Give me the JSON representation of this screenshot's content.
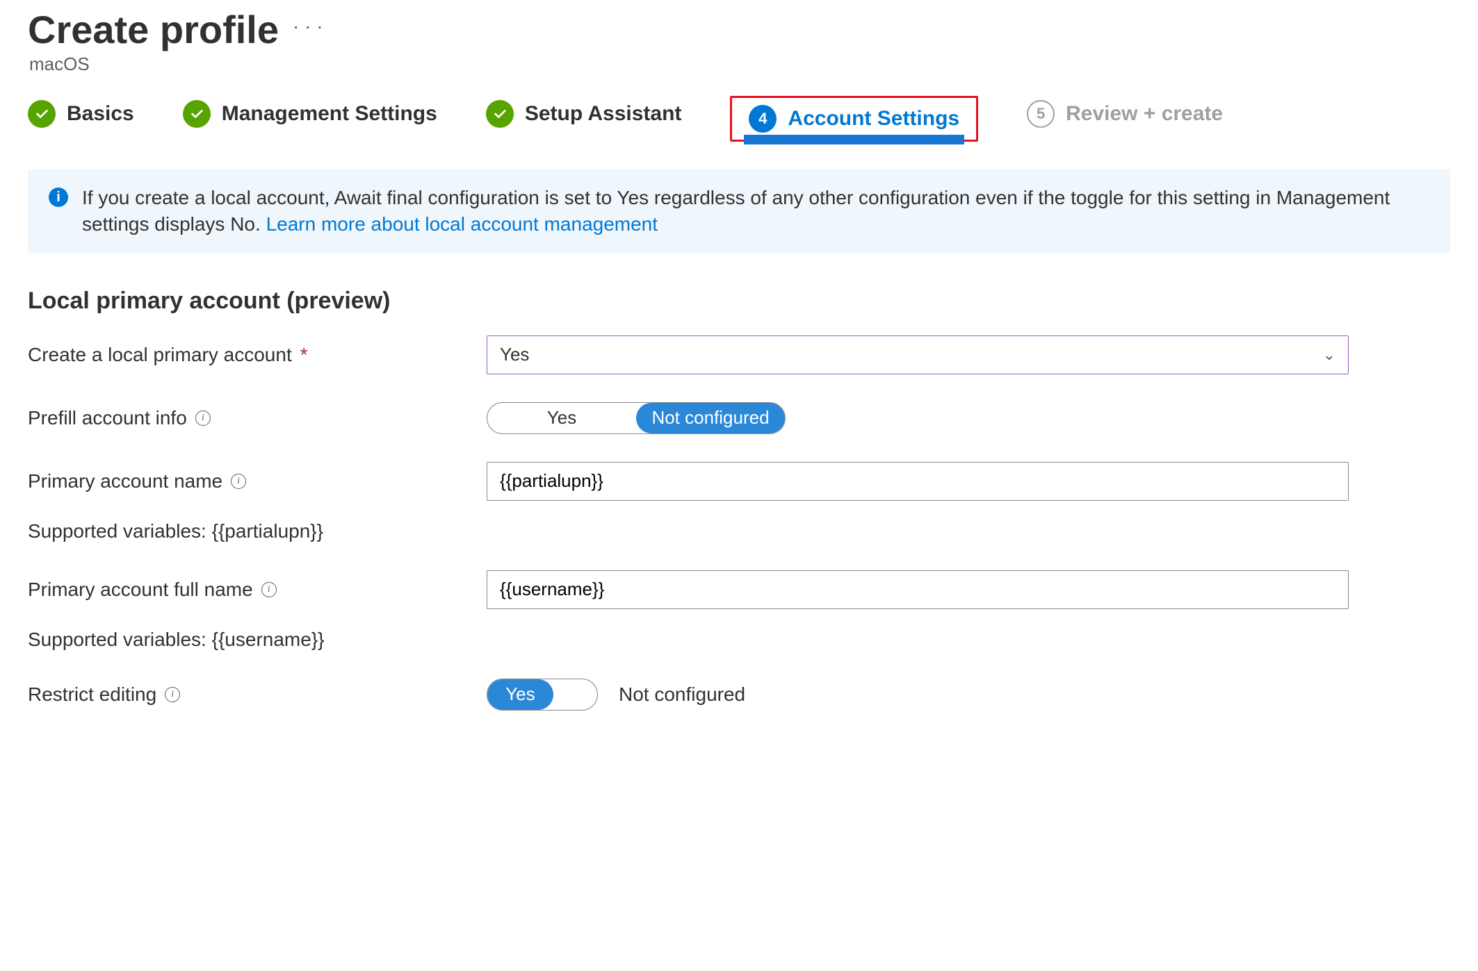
{
  "header": {
    "title": "Create profile",
    "subtitle": "macOS",
    "more": "· · ·"
  },
  "wizard": {
    "basics": "Basics",
    "management": "Management Settings",
    "setup": "Setup Assistant",
    "account": "Account Settings",
    "account_num": "4",
    "review": "Review + create",
    "review_num": "5"
  },
  "banner": {
    "text_before": "If you create a local account, Await final configuration is set to Yes regardless of any other configuration even if the toggle for this setting in Management settings displays No. ",
    "link": "Learn more about local account management"
  },
  "section_heading": "Local primary account (preview)",
  "labels": {
    "create_local": "Create a local primary account",
    "prefill": "Prefill account info",
    "primary_name": "Primary account name",
    "supported_partial": "Supported variables: {{partialupn}}",
    "primary_full": "Primary account full name",
    "supported_user": "Supported variables: {{username}}",
    "restrict": "Restrict editing"
  },
  "values": {
    "create_local_value": "Yes",
    "toggle_yes": "Yes",
    "toggle_not_configured": "Not configured",
    "primary_name_value": "{{partialupn}}",
    "primary_full_value": "{{username}}"
  }
}
